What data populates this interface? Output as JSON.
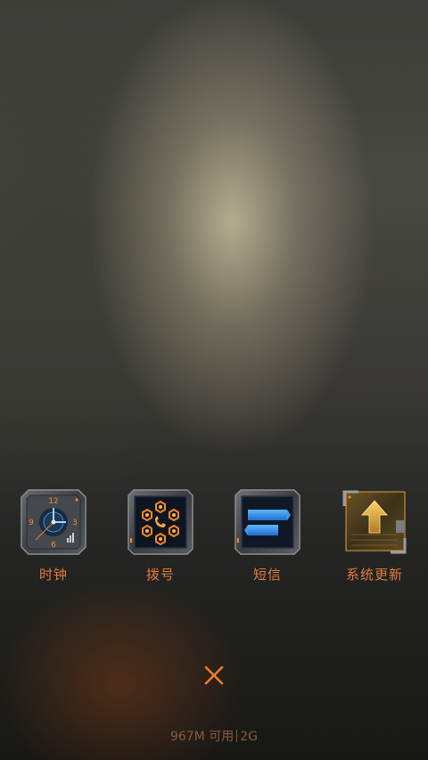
{
  "apps": [
    {
      "label": "时钟",
      "icon": "clock-icon"
    },
    {
      "label": "拨号",
      "icon": "dialer-icon"
    },
    {
      "label": "短信",
      "icon": "message-icon"
    },
    {
      "label": "系统更新",
      "icon": "system-update-icon"
    }
  ],
  "clock_face": {
    "n12": "12",
    "n3": "3",
    "n6": "6",
    "n9": "9"
  },
  "close_icon": "close-icon",
  "memory": {
    "available": "967M 可用",
    "total": "2G"
  },
  "colors": {
    "label": "#e07b3c",
    "accent_orange": "#f08a2a",
    "accent_blue": "#2f8fe8",
    "accent_gold": "#d9a23a",
    "status": "#8a5a3c"
  }
}
